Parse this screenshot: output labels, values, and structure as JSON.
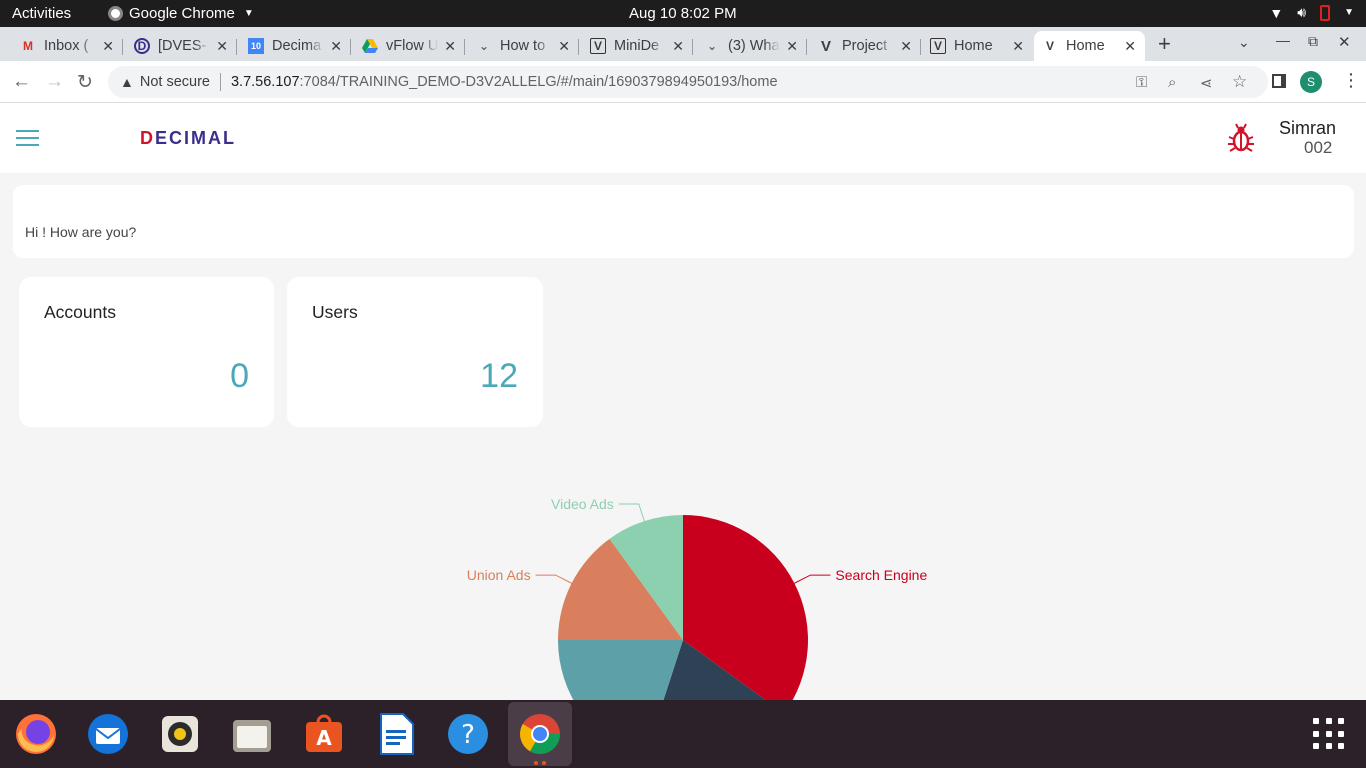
{
  "system_bar": {
    "activities": "Activities",
    "app_name": "Google Chrome",
    "clock": "Aug 10  8:02 PM"
  },
  "tabs": [
    {
      "title": "Inbox (",
      "favicon": "gmail-icon"
    },
    {
      "title": "[DVES-",
      "favicon": "decimal-icon"
    },
    {
      "title": "Decima",
      "favicon": "calendar-icon"
    },
    {
      "title": "vFlow U",
      "favicon": "drive-icon"
    },
    {
      "title": "How to",
      "favicon": "generic-icon"
    },
    {
      "title": "MiniDe",
      "favicon": "vflow-icon"
    },
    {
      "title": "(3) Wha",
      "favicon": "generic-icon"
    },
    {
      "title": "Project",
      "favicon": "v-logo-icon"
    },
    {
      "title": "Home",
      "favicon": "vflow-icon"
    },
    {
      "title": "Home",
      "favicon": "vflow-icon",
      "active": true
    }
  ],
  "address_bar": {
    "security_label": "Not secure",
    "host": "3.7.56.107",
    "path": ":7084/TRAINING_DEMO-D3V2ALLELG/#/main/1690379894950193/home"
  },
  "profile_initial": "S",
  "app": {
    "logo_text": "DECIMAL",
    "user": {
      "name": "Simran",
      "id": "002"
    },
    "greeting": "Hi ! How are you?",
    "cards": [
      {
        "title": "Accounts",
        "value": "0"
      },
      {
        "title": "Users",
        "value": "12"
      }
    ]
  },
  "chart_data": {
    "type": "pie",
    "slices": [
      {
        "name": "Search Engine",
        "value": 35,
        "color": "#c8001e"
      },
      {
        "name": "",
        "value": 20,
        "color": "#2f4154"
      },
      {
        "name": "",
        "value": 20,
        "color": "#5ea0a8"
      },
      {
        "name": "Union Ads",
        "value": 15,
        "color": "#d97f5d"
      },
      {
        "name": "Video Ads",
        "value": 10,
        "color": "#8dd0af"
      }
    ]
  }
}
